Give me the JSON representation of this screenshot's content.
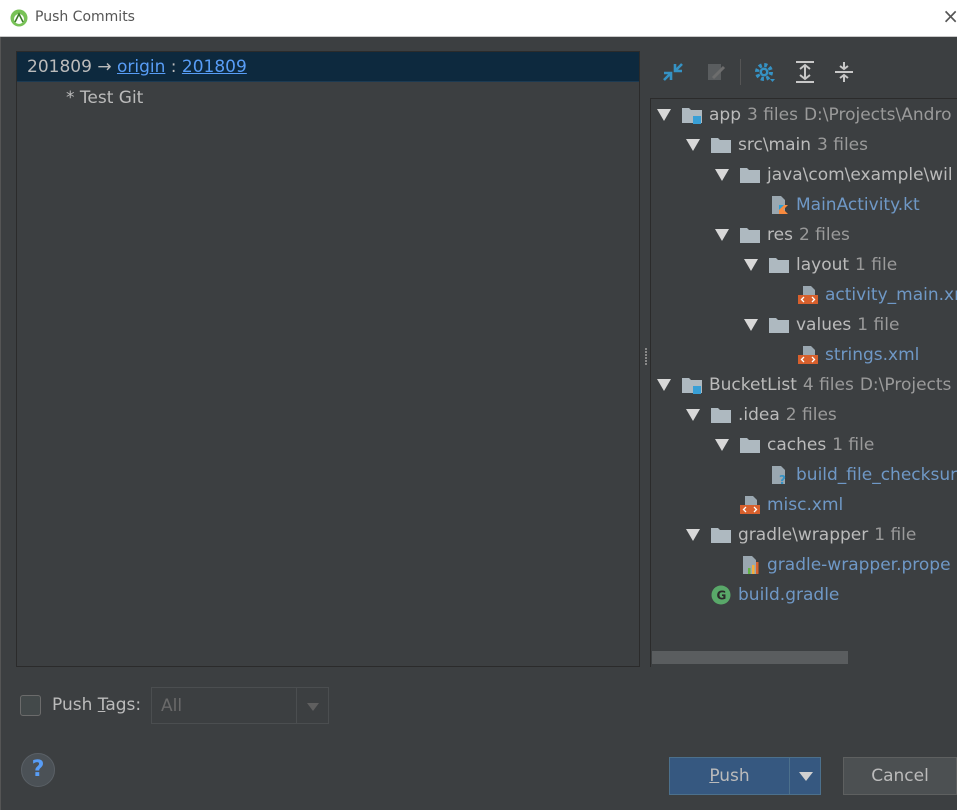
{
  "window": {
    "title": "Push Commits",
    "close_glyph": "×"
  },
  "commits": {
    "local_branch": "201809",
    "arrow": "→",
    "remote": "origin",
    "colon": ":",
    "remote_branch": "201809",
    "message": "* Test Git"
  },
  "tree": {
    "nodes": [
      {
        "label": "app",
        "count": "3 files",
        "extra": "D:\\Projects\\Andro",
        "icon": "module-folder-icon",
        "level": 0,
        "expanded": true
      },
      {
        "label": "src\\main",
        "count": "3 files",
        "icon": "folder-icon",
        "level": 1,
        "expanded": true
      },
      {
        "label": "java\\com\\example\\wil",
        "count": "",
        "icon": "folder-icon",
        "level": 2,
        "expanded": true
      },
      {
        "label": "MainActivity.kt",
        "icon": "kotlin-file-icon",
        "level": 3,
        "file": true
      },
      {
        "label": "res",
        "count": "2 files",
        "icon": "folder-icon",
        "level": 2,
        "expanded": true
      },
      {
        "label": "layout",
        "count": "1 file",
        "icon": "folder-icon",
        "level": 3,
        "expanded": true
      },
      {
        "label": "activity_main.xm",
        "icon": "xml-file-icon",
        "level": 4,
        "file": true
      },
      {
        "label": "values",
        "count": "1 file",
        "icon": "folder-icon",
        "level": 3,
        "expanded": true
      },
      {
        "label": "strings.xml",
        "icon": "xml-file-icon",
        "level": 4,
        "file": true
      },
      {
        "label": "BucketList",
        "count": "4 files",
        "extra": "D:\\Projects",
        "icon": "module-folder-icon",
        "level": 0,
        "expanded": true
      },
      {
        "label": ".idea",
        "count": "2 files",
        "icon": "folder-icon",
        "level": 1,
        "expanded": true
      },
      {
        "label": "caches",
        "count": "1 file",
        "icon": "folder-icon",
        "level": 2,
        "expanded": true
      },
      {
        "label": "build_file_checksur",
        "icon": "unknown-file-icon",
        "level": 3,
        "file": true
      },
      {
        "label": "misc.xml",
        "icon": "xml-file-icon",
        "level": 2,
        "file": true
      },
      {
        "label": "gradle\\wrapper",
        "count": "1 file",
        "icon": "folder-icon",
        "level": 1,
        "expanded": true
      },
      {
        "label": "gradle-wrapper.prope",
        "icon": "properties-file-icon",
        "level": 2,
        "file": true
      },
      {
        "label": "build.gradle",
        "icon": "gradle-file-icon",
        "level": 1,
        "file": true
      }
    ]
  },
  "bottom": {
    "push_tags_prefix": "Push ",
    "push_tags_mnemonic": "T",
    "push_tags_suffix": "ags:",
    "tags_combo_value": "All",
    "help_glyph": "?",
    "push_mnemonic": "P",
    "push_rest": "ush",
    "cancel_label": "Cancel"
  },
  "colors": {
    "background": "#3c3f41",
    "selection": "#0d293e",
    "link": "#589df6",
    "file_text": "#6f98c6",
    "push_button": "#365880"
  }
}
